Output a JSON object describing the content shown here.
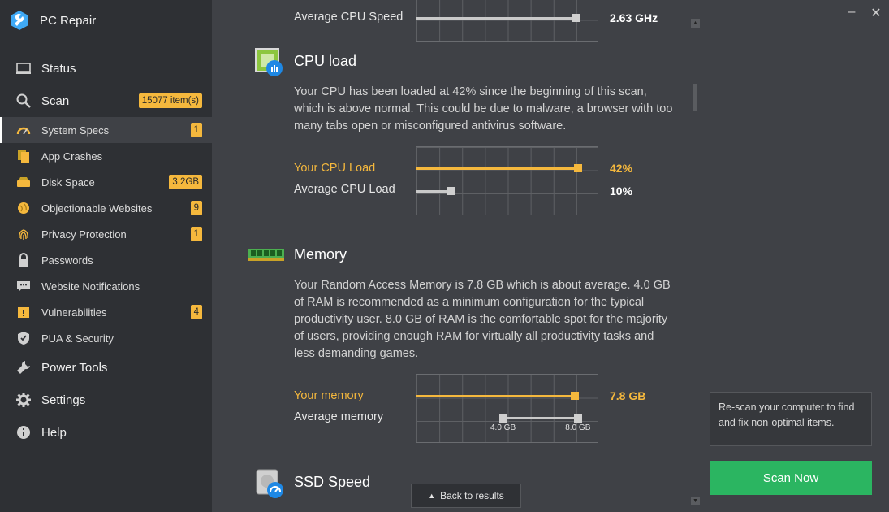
{
  "app": {
    "title": "PC Repair"
  },
  "sidebar": {
    "items": [
      {
        "label": "Status",
        "size": "big",
        "icon": "monitor-icon"
      },
      {
        "label": "Scan",
        "size": "big",
        "icon": "search-icon",
        "badge": "15077 item(s)"
      },
      {
        "label": "System Specs",
        "size": "small",
        "icon": "speedometer-icon",
        "badge": "1",
        "active": true
      },
      {
        "label": "App Crashes",
        "size": "small",
        "icon": "documents-icon"
      },
      {
        "label": "Disk Space",
        "size": "small",
        "icon": "disk-icon",
        "badge": "3.2GB"
      },
      {
        "label": "Objectionable Websites",
        "size": "small",
        "icon": "globe-icon",
        "badge": "9"
      },
      {
        "label": "Privacy Protection",
        "size": "small",
        "icon": "fingerprint-icon",
        "badge": "1"
      },
      {
        "label": "Passwords",
        "size": "small",
        "icon": "lock-icon"
      },
      {
        "label": "Website Notifications",
        "size": "small",
        "icon": "chat-bubble-icon"
      },
      {
        "label": "Vulnerabilities",
        "size": "small",
        "icon": "warning-folder-icon",
        "badge": "4"
      },
      {
        "label": "PUA & Security",
        "size": "small",
        "icon": "shield-icon"
      },
      {
        "label": "Power Tools",
        "size": "big",
        "icon": "wrench-icon"
      },
      {
        "label": "Settings",
        "size": "big",
        "icon": "gear-icon"
      },
      {
        "label": "Help",
        "size": "big",
        "icon": "info-icon"
      }
    ]
  },
  "cpu_speed": {
    "label": "Average CPU Speed",
    "value": "2.63 GHz",
    "level": 0.88
  },
  "cpu_load": {
    "title": "CPU load",
    "description": "Your CPU has been loaded at 42% since the beginning of this scan, which is above normal. This could be due to malware, a browser with too many tabs open or misconfigured antivirus software.",
    "yours": {
      "label": "Your CPU Load",
      "value": "42%",
      "level": 0.89
    },
    "average": {
      "label": "Average CPU Load",
      "value": "10%",
      "level": 0.19
    }
  },
  "memory": {
    "title": "Memory",
    "description": "Your Random Access Memory is 7.8 GB which is about average. 4.0 GB of RAM is recommended as a minimum configuration for the typical productivity user. 8.0 GB of RAM is the comfortable spot for the majority of users, providing enough RAM for virtually all productivity tasks and less demanding games.",
    "yours": {
      "label": "Your memory",
      "value": "7.8 GB",
      "level": 0.87
    },
    "average": {
      "label": "Average memory",
      "low_label": "4.0 GB",
      "high_label": "8.0 GB",
      "low_level": 0.48,
      "high_level": 0.89
    }
  },
  "ssd": {
    "title": "SSD Speed"
  },
  "footer": {
    "back_label": "Back to results"
  },
  "right_panel": {
    "rescan_text": "Re-scan your computer to find and fix non-optimal items.",
    "scan_now_label": "Scan Now"
  },
  "colors": {
    "accent": "#f5b83d",
    "scan_button": "#2bb561",
    "sidebar": "#2e3034",
    "background": "#3f4146"
  }
}
